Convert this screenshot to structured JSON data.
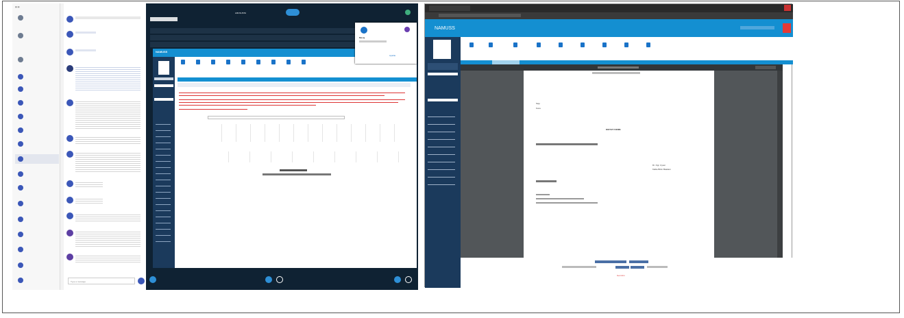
{
  "chat": {
    "nav_items": [
      "Calendar",
      "Files",
      "Activity"
    ],
    "search_placeholder": "Type a message"
  },
  "middle": {
    "topbar_title": "AIM NUSTA",
    "app_name": "NAMUSS",
    "popup_title": "Mesaj",
    "popup_link": "Ayarlar"
  },
  "browser": {
    "app_name": "NAMUSS",
    "pdf_title": "DIKTAT FORMU",
    "doc_lines": [
      "Sayı",
      "Konu"
    ],
    "sign_line_1": "Dr. Ogr. Uyesi",
    "sign_line_2": "Kalite Birim Baskanı",
    "footer_link": "Geri dön"
  },
  "colors": {
    "accent": "#148fd1",
    "dark": "#0f2233",
    "sidebar": "#1b3a5c",
    "alert": "#d33"
  }
}
